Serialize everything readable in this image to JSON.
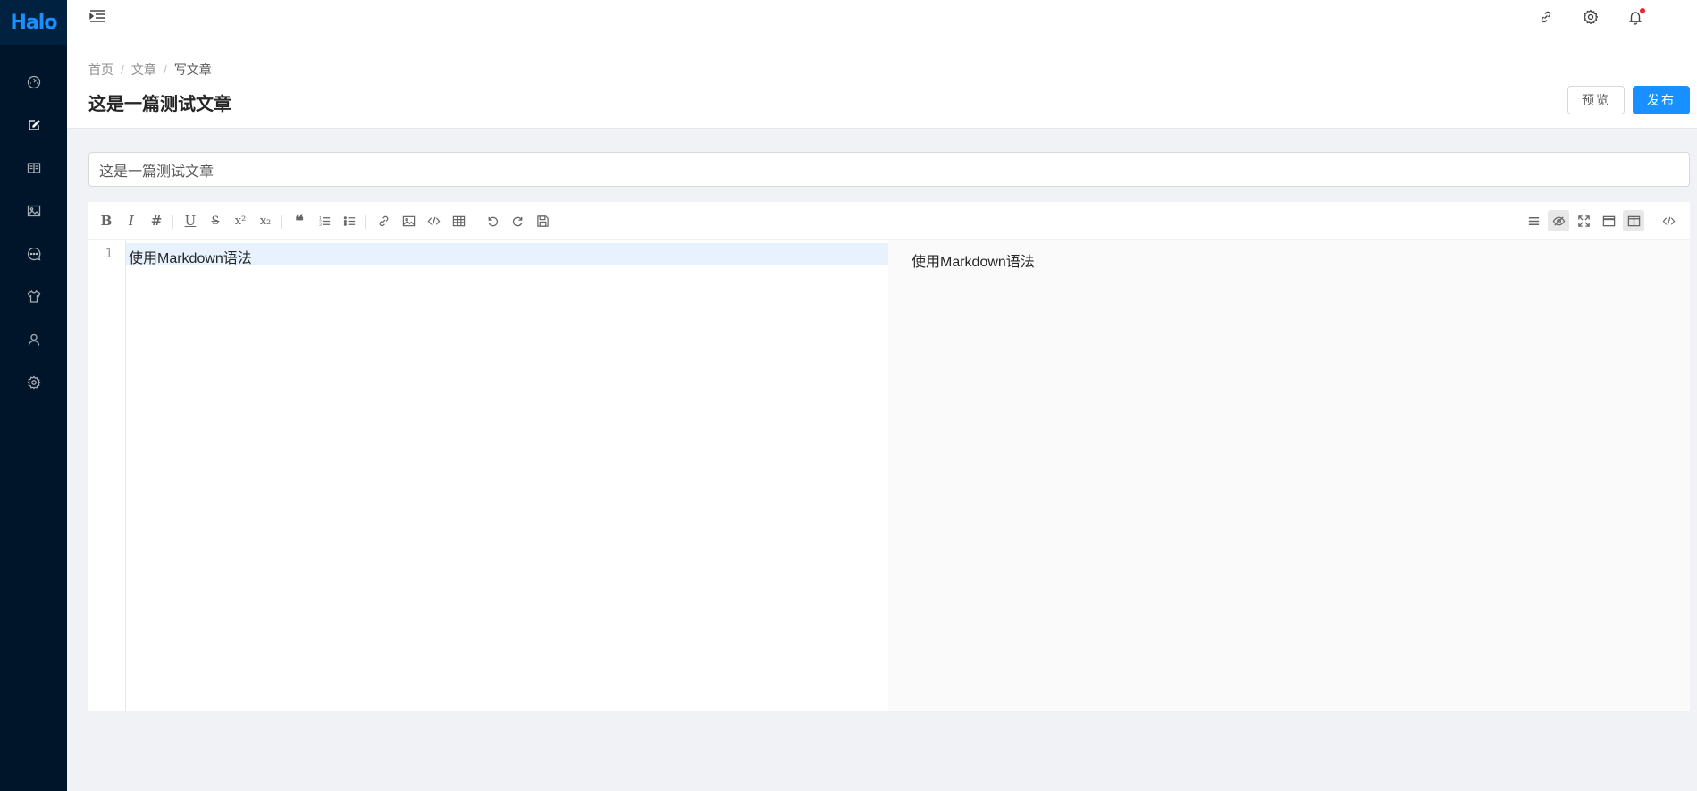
{
  "logo": "Halo",
  "breadcrumb": [
    "首页",
    "文章",
    "写文章"
  ],
  "page_title": "这是一篇测试文章",
  "actions": {
    "preview": "预览",
    "publish": "发布"
  },
  "post_title_value": "这是一篇测试文章",
  "editor": {
    "line_number": "1",
    "line_1": "使用Markdown语法",
    "preview_text": "使用Markdown语法"
  },
  "toolbar_glyphs": {
    "bold": "B",
    "italic": "I",
    "header": "#",
    "underline": "U",
    "strike": "S",
    "superscript": "x²",
    "subscript": "x₂",
    "quote": "❝"
  },
  "colors": {
    "sidebar": "#001529",
    "accent": "#1890ff",
    "badge": "#f5222d"
  }
}
